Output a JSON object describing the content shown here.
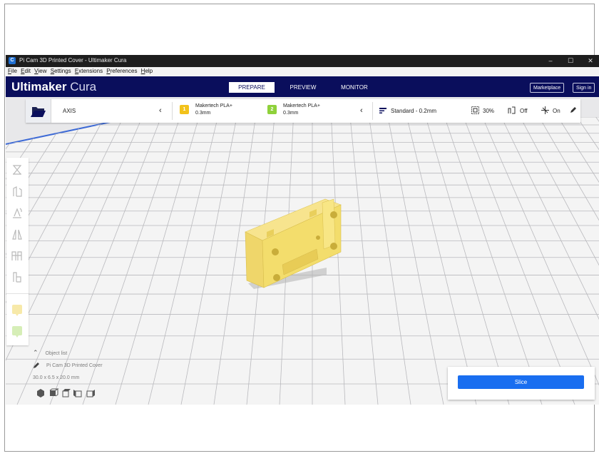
{
  "window": {
    "title": "Pi Cam 3D Printed Cover - Ultimaker Cura",
    "app_icon": "C",
    "minimize": "–",
    "maximize": "☐",
    "close": "✕"
  },
  "menu": [
    {
      "key": "F",
      "rest": "ile"
    },
    {
      "key": "E",
      "rest": "dit"
    },
    {
      "key": "V",
      "rest": "iew"
    },
    {
      "key": "S",
      "rest": "ettings"
    },
    {
      "key": "E",
      "rest": "xtensions"
    },
    {
      "key": "P",
      "rest": "references"
    },
    {
      "key": "H",
      "rest": "elp"
    }
  ],
  "header": {
    "brand_bold": "Ultimaker",
    "brand_light": "Cura",
    "stages": [
      "PREPARE",
      "PREVIEW",
      "MONITOR"
    ],
    "marketplace": "Marketplace",
    "sign_in": "Sign in"
  },
  "toolbar": {
    "printer": "AXIS",
    "printer_chevron": "‹",
    "extruder1": {
      "number": "1",
      "material": "Makertech PLA+",
      "nozzle": "0.3mm",
      "color": "#f2c21b"
    },
    "extruder2": {
      "number": "2",
      "material": "Makertech PLA+",
      "nozzle": "0.3mm",
      "color": "#8fd13b"
    },
    "extruder_chevron": "‹",
    "profile": "Standard - 0.2mm",
    "infill": "30%",
    "support": "Off",
    "adhesion": "On"
  },
  "object": {
    "list_label": "Object list",
    "name": "Pi Cam 3D Printed Cover",
    "dimensions": "30.0 x 6.5 x 20.0 mm",
    "color": "#f4df6f"
  },
  "slice": {
    "label": "Slice"
  },
  "colors": {
    "header": "#0a0e5c",
    "accent": "#196ef0"
  }
}
